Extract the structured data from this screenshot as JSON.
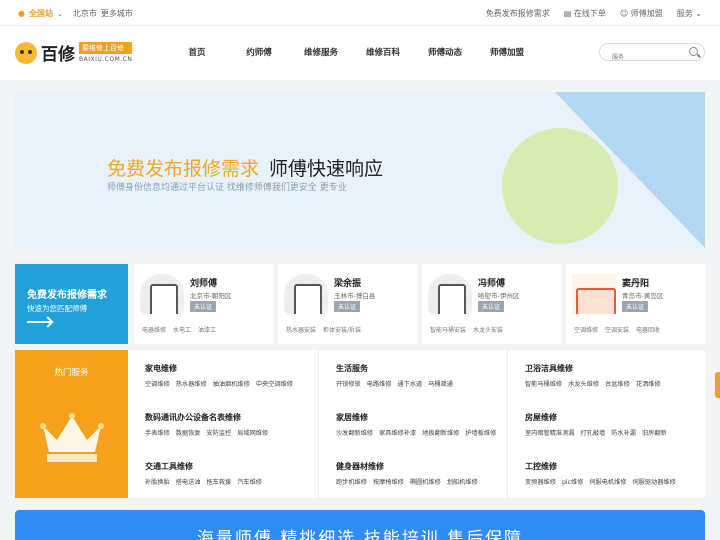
{
  "topbar": {
    "station": "全国站",
    "city": "北京市",
    "more_cities": "更多城市",
    "links": [
      "免费发布报修需求",
      "在线下单",
      "师傅加盟",
      "服务"
    ]
  },
  "header": {
    "logo_name": "百修",
    "slogan": "要维修上百修",
    "domain": "BAIXIU.COM.CN",
    "nav": [
      "首页",
      "约师傅",
      "维修服务",
      "维修百科",
      "师傅动态",
      "师傅加盟"
    ],
    "search_placeholder": "服务"
  },
  "banner": {
    "title_highlight": "免费发布报修需求",
    "title_dark": "师傅快速响应",
    "subtitle": "师傅身份信息均通过平台认证 找维修师傅我们更安全 更专业"
  },
  "request_card": {
    "title": "免费发布报修需求",
    "subtitle": "快速为您匹配师傅"
  },
  "masters": [
    {
      "name": "刘师傅",
      "location": "北京市-朝阳区",
      "badge": "未认证",
      "tags": [
        "电器维修",
        "水电工",
        "油漆工"
      ]
    },
    {
      "name": "梁余振",
      "location": "玉林市-博白县",
      "badge": "未认证",
      "tags": [
        "热水器安装",
        "柜体安装/拆装"
      ]
    },
    {
      "name": "冯师傅",
      "location": "哈密市-伊州区",
      "badge": "未认证",
      "tags": [
        "智能马桶安装",
        "水龙头安装"
      ]
    },
    {
      "name": "窦丹阳",
      "location": "青岛市-黄岛区",
      "badge": "未认证",
      "tags": [
        "空调维修",
        "空调安装",
        "电器回收"
      ]
    }
  ],
  "hot_services": {
    "title": "热门服务",
    "columns": [
      [
        {
          "heading": "家电维修",
          "items": [
            "空调维修",
            "热水器维修",
            "抽油烟机维修",
            "中央空调维修"
          ]
        },
        {
          "heading": "数码通讯办公设备名表维修",
          "items": [
            "手表维修",
            "数据恢复",
            "安防监控",
            "局域网维修"
          ]
        },
        {
          "heading": "交通工具维修",
          "items": [
            "补胎换胎",
            "搭电送油",
            "拖车救援",
            "汽车维修"
          ]
        }
      ],
      [
        {
          "heading": "生活服务",
          "items": [
            "开锁修锁",
            "电路维修",
            "通下水道",
            "马桶疏通"
          ]
        },
        {
          "heading": "家居维修",
          "items": [
            "沙发翻新维修",
            "家具维修补漆",
            "地板翻新维修",
            "护墙板维修"
          ]
        },
        {
          "heading": "健身器材维修",
          "items": [
            "跑步机维修",
            "按摩椅维修",
            "椭圆机维修",
            "划船机维修"
          ]
        }
      ],
      [
        {
          "heading": "卫浴洁具维修",
          "items": [
            "智能马桶维修",
            "水龙头维修",
            "台盆维修",
            "花洒维修"
          ]
        },
        {
          "heading": "房屋维修",
          "items": [
            "室内暗管精准测漏",
            "打孔敲墙",
            "防水补漏",
            "旧房翻新"
          ]
        },
        {
          "heading": "工控维修",
          "items": [
            "变频器维修",
            "plc维修",
            "伺服电机维修",
            "伺服驱动器维修"
          ]
        }
      ]
    ]
  },
  "bottom_banner": {
    "text": "海量师傅 精挑细选 技能培训 售后保障"
  }
}
